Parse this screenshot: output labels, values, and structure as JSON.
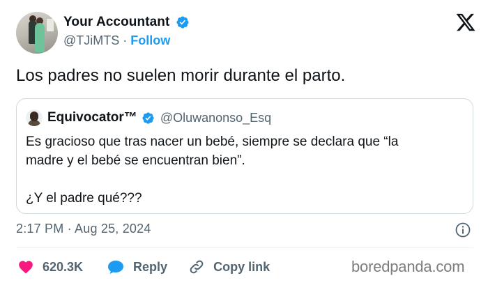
{
  "post": {
    "author": {
      "display_name": "Your Accountant",
      "handle": "@TJiMTS",
      "separator": "·",
      "follow_label": "Follow",
      "verified": true
    },
    "text": "Los padres no suelen morir durante el parto.",
    "quoted": {
      "display_name": "Equivocator™",
      "handle": "@Oluwanonso_Esq",
      "verified": true,
      "text_line1": "Es gracioso que tras nacer un bebé, siempre se declara que “la",
      "text_line2": "madre y el bebé se encuentran bien”.",
      "text_line3": "¿Y el padre qué???"
    },
    "timestamp": "2:17 PM · Aug 25, 2024",
    "actions": {
      "likes": "620.3K",
      "reply_label": "Reply",
      "copy_link_label": "Copy link"
    }
  },
  "watermark": "boredpanda.com",
  "icons": {
    "close": "x-logo-icon",
    "verified": "verified-badge-icon",
    "info": "info-icon",
    "like": "heart-icon",
    "reply": "speech-bubble-icon",
    "copy": "link-icon"
  },
  "colors": {
    "accent": "#1d9bf0",
    "like": "#f91880",
    "text": "#0f1419",
    "secondary": "#536471"
  }
}
